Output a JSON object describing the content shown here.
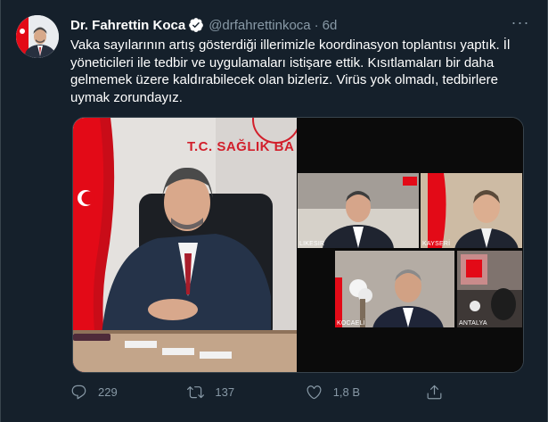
{
  "tweet": {
    "author_name": "Dr. Fahrettin Koca",
    "handle": "@drfahrettinkoca",
    "separator": "·",
    "time": "6d",
    "more_label": "···",
    "text": "Vaka sayılarının artış gösterdiği illerimizle koordinasyon toplantısı yaptık. İl yöneticileri ile tedbir ve uygulamaları istişare ettik. Kısıtlamaları bir daha gelmemek üzere kaldırabilecek olan bizleriz. Virüs yok olmadı, tedbirlere uymak zorundayız."
  },
  "media": {
    "sign_text": "T.C. SAĞLIK BA",
    "video_tiles": [
      {
        "label": "LIKESIR"
      },
      {
        "label": "KAYSERİ"
      },
      {
        "label": "KOCAELİ"
      },
      {
        "label": "ANTALYA"
      }
    ]
  },
  "actions": {
    "reply_count": "229",
    "retweet_count": "137",
    "like_count": "1,8 B",
    "share_label": ""
  },
  "colors": {
    "background": "#15202b",
    "secondary_text": "#8899a6",
    "verified_badge": "#ffffff",
    "flag_red": "#e30a17"
  },
  "icons": {
    "verified": "verified-badge-icon",
    "reply": "reply-icon",
    "retweet": "retweet-icon",
    "like": "heart-icon",
    "share": "share-icon",
    "more": "more-icon"
  }
}
